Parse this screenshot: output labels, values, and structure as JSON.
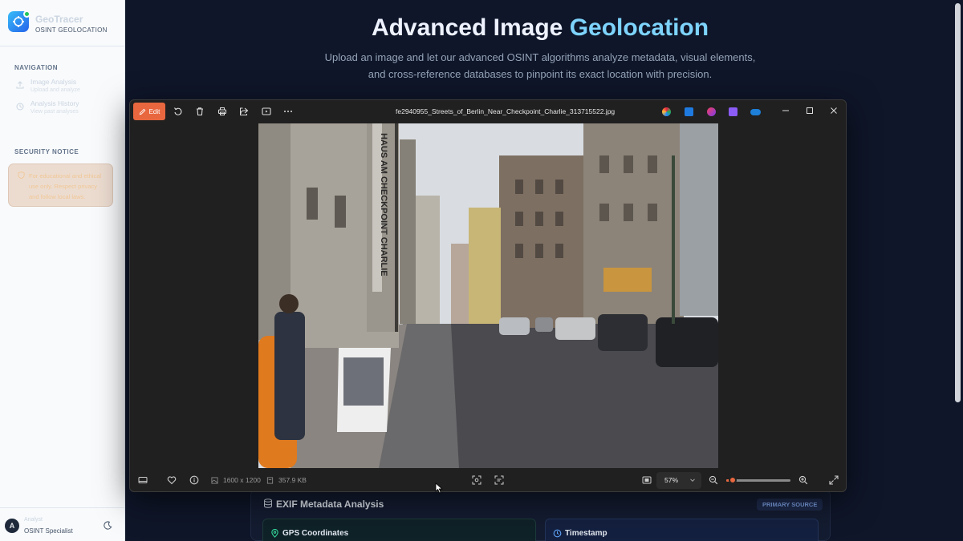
{
  "brand": {
    "name": "GeoTracer",
    "subtitle": "OSINT GEOLOCATION"
  },
  "navigation": {
    "heading": "NAVIGATION",
    "items": [
      {
        "label": "Image Analysis",
        "sub": "Upload and analyze",
        "icon": "upload-icon"
      },
      {
        "label": "Analysis History",
        "sub": "View past analyses",
        "icon": "history-icon"
      }
    ]
  },
  "security": {
    "heading": "SECURITY NOTICE",
    "text": "For educational and ethical use only. Respect privacy and follow local laws.",
    "icon": "shield-icon"
  },
  "user": {
    "initial": "A",
    "name": "Analyst",
    "role": "OSINT Specialist"
  },
  "hero": {
    "title_main": "Advanced Image",
    "title_accent": "Geolocation",
    "description": "Upload an image and let our advanced OSINT algorithms analyze metadata, visual elements, and cross-reference databases to pinpoint its exact location with precision."
  },
  "exif": {
    "title": "EXIF Metadata Analysis",
    "badge": "PRIMARY SOURCE",
    "cards": [
      {
        "label": "GPS Coordinates",
        "icon": "map-pin-icon"
      },
      {
        "label": "Timestamp",
        "icon": "clock-icon"
      }
    ]
  },
  "viewer": {
    "edit_label": "Edit",
    "filename": "fe2940955_Streets_of_Berlin_Near_Checkpoint_Charlie_313715522.jpg",
    "dimensions": "1600 x 1200",
    "file_size": "357.9 KB",
    "zoom": "57%",
    "zoom_fraction": 0.1,
    "photo_sign": "HAUS AM CHECKPOINT CHARLIE"
  },
  "colors": {
    "accent": "#e8673f",
    "brand": "#2563eb",
    "title_accent": "#7dd3fc",
    "bg": "#0f1629"
  }
}
